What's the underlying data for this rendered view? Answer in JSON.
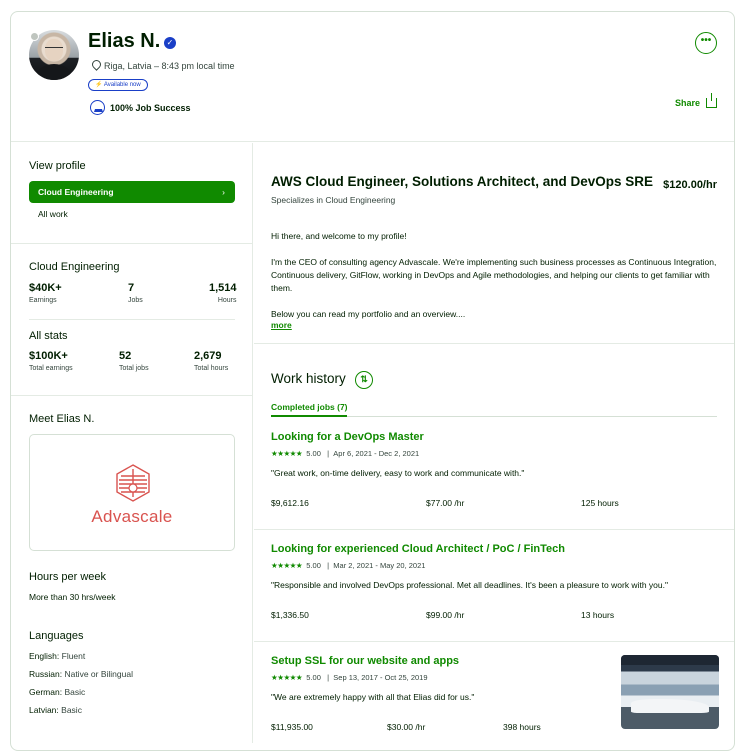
{
  "profile": {
    "name": "Elias N.",
    "location": "Riga, Latvia – 8:43 pm local time",
    "available_badge": "Available now",
    "job_success": "100% Job Success",
    "share_label": "Share",
    "more_label": "•••"
  },
  "sidebar": {
    "view_profile_title": "View profile",
    "specialization_button": "Cloud Engineering",
    "all_work": "All work",
    "cloud_stats": {
      "title": "Cloud Engineering",
      "earnings": {
        "value": "$40K+",
        "label": "Earnings"
      },
      "jobs": {
        "value": "7",
        "label": "Jobs"
      },
      "hours": {
        "value": "1,514",
        "label": "Hours"
      }
    },
    "all_stats": {
      "title": "All stats",
      "earnings": {
        "value": "$100K+",
        "label": "Total earnings"
      },
      "jobs": {
        "value": "52",
        "label": "Total jobs"
      },
      "hours": {
        "value": "2,679",
        "label": "Total hours"
      }
    },
    "meet_title": "Meet Elias N.",
    "company_name": "Advascale",
    "hours_per_week_title": "Hours per week",
    "hours_per_week_value": "More than 30 hrs/week",
    "languages_title": "Languages",
    "languages": [
      {
        "name": "English:",
        "level": "Fluent"
      },
      {
        "name": "Russian:",
        "level": "Native or Bilingual"
      },
      {
        "name": "German:",
        "level": "Basic"
      },
      {
        "name": "Latvian:",
        "level": "Basic"
      }
    ]
  },
  "main": {
    "title": "AWS Cloud Engineer, Solutions Architect, and DevOps SRE",
    "rate": "$120.00/hr",
    "specializes": "Specializes in Cloud Engineering",
    "intro_1": "Hi there, and welcome to my profile!",
    "intro_2": "I'm the CEO of consulting agency Advascale. We're implementing such business processes as Continuous Integration, Continuous delivery, GitFlow, working in DevOps and Agile methodologies, and helping our clients to get familiar with them.",
    "intro_3": "Below you can read my portfolio and an overview....",
    "more_link": "more",
    "work_history_title": "Work history",
    "completed_tab": "Completed jobs (7)",
    "jobs": [
      {
        "title": "Looking for a DevOps Master",
        "stars": "★★★★★",
        "score": "5.00",
        "dates": "Apr 6, 2021 - Dec 2, 2021",
        "quote": "\"Great work, on-time delivery, easy to work and communicate with.\"",
        "earned": "$9,612.16",
        "rate": "$77.00 /hr",
        "hours": "125 hours"
      },
      {
        "title": "Looking for experienced Cloud Architect / PoC / FinTech",
        "stars": "★★★★★",
        "score": "5.00",
        "dates": "Mar 2, 2021 - May 20, 2021",
        "quote": "\"Responsible and involved DevOps professional. Met all deadlines. It's been a pleasure to work with you.\"",
        "earned": "$1,336.50",
        "rate": "$99.00 /hr",
        "hours": "13 hours"
      },
      {
        "title": "Setup SSL for our website and apps",
        "stars": "★★★★★",
        "score": "5.00",
        "dates": "Sep 13, 2017 - Oct 25, 2019",
        "quote": "\"We are extremely happy with all that Elias did for us.\"",
        "earned": "$11,935.00",
        "rate": "$30.00 /hr",
        "hours": "398 hours"
      }
    ]
  },
  "colors": {
    "accent": "#108a00",
    "verified": "#1a3fc7",
    "brand_logo": "#d9534f"
  }
}
